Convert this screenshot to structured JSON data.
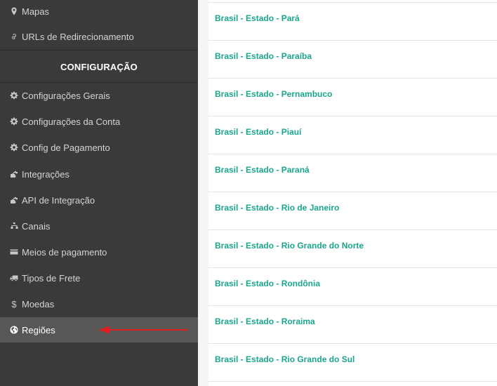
{
  "sidebar": {
    "top_items": [
      {
        "label": "Mapas",
        "icon": "map-marker-icon"
      },
      {
        "label": "URLs de Redirecionamento",
        "icon": "link-icon"
      }
    ],
    "section_title": "CONFIGURAÇÃO",
    "items": [
      {
        "label": "Configurações Gerais",
        "icon": "gear-icon"
      },
      {
        "label": "Configurações da Conta",
        "icon": "gear-icon"
      },
      {
        "label": "Config de Pagamento",
        "icon": "gear-icon"
      },
      {
        "label": "Integrações",
        "icon": "puzzle-icon"
      },
      {
        "label": "API de Integração",
        "icon": "puzzle-icon"
      },
      {
        "label": "Canais",
        "icon": "sitemap-icon"
      },
      {
        "label": "Meios de pagamento",
        "icon": "credit-card-icon"
      },
      {
        "label": "Tipos de Frete",
        "icon": "truck-icon"
      },
      {
        "label": "Moedas",
        "icon": "dollar-icon"
      },
      {
        "label": "Regiões",
        "icon": "globe-icon",
        "active": true
      }
    ],
    "annotation_color": "#e02020"
  },
  "regions": [
    "Brasil - Estado - Pará",
    "Brasil - Estado - Paraíba",
    "Brasil - Estado - Pernambuco",
    "Brasil - Estado - Piauí",
    "Brasil - Estado - Paraná",
    "Brasil - Estado - Rio de Janeiro",
    "Brasil - Estado - Rio Grande do Norte",
    "Brasil - Estado - Rondônia",
    "Brasil - Estado - Roraima",
    "Brasil - Estado - Rio Grande do Sul"
  ],
  "colors": {
    "sidebar_bg": "#3a3a3a",
    "active_bg": "#575757",
    "link": "#1aa68a"
  }
}
